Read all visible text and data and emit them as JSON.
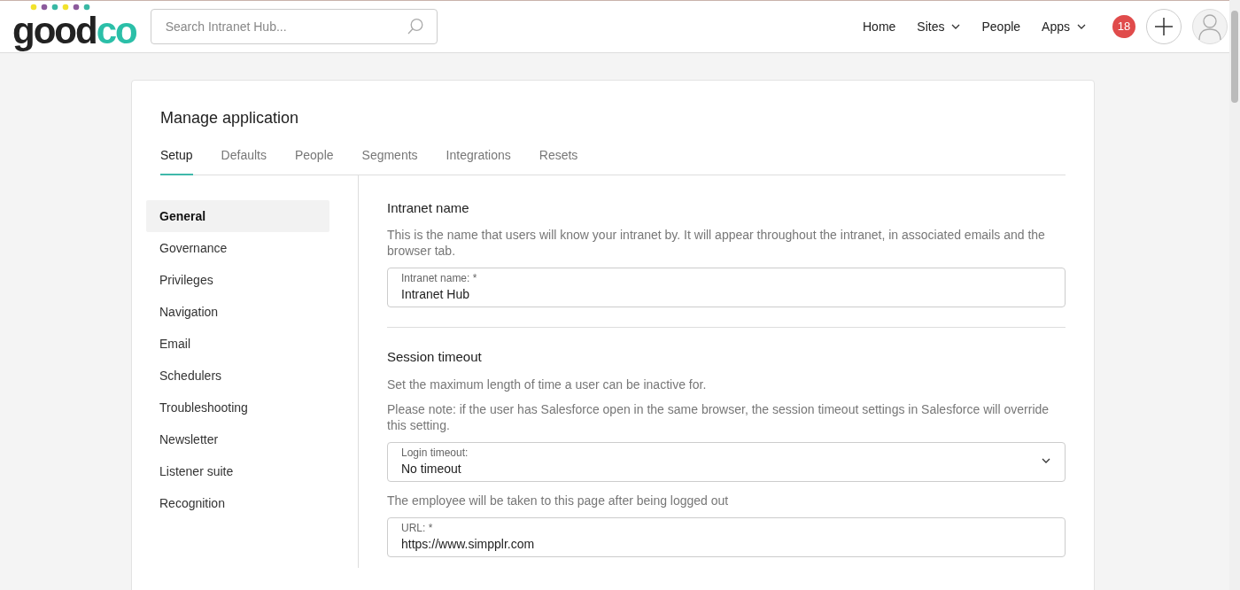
{
  "header": {
    "logo": {
      "main": "good",
      "accent": "co"
    },
    "search": {
      "placeholder": "Search Intranet Hub..."
    },
    "nav": [
      {
        "label": "Home",
        "dropdown": false
      },
      {
        "label": "Sites",
        "dropdown": true
      },
      {
        "label": "People",
        "dropdown": false
      },
      {
        "label": "Apps",
        "dropdown": true
      }
    ],
    "notifications": "18"
  },
  "title": "Manage application",
  "tabs": [
    {
      "label": "Setup",
      "selected": true
    },
    {
      "label": "Defaults",
      "selected": false
    },
    {
      "label": "People",
      "selected": false
    },
    {
      "label": "Segments",
      "selected": false
    },
    {
      "label": "Integrations",
      "selected": false
    },
    {
      "label": "Resets",
      "selected": false
    }
  ],
  "sidebar": {
    "items": [
      {
        "label": "General",
        "selected": true
      },
      {
        "label": "Governance",
        "selected": false
      },
      {
        "label": "Privileges",
        "selected": false
      },
      {
        "label": "Navigation",
        "selected": false
      },
      {
        "label": "Email",
        "selected": false
      },
      {
        "label": "Schedulers",
        "selected": false
      },
      {
        "label": "Troubleshooting",
        "selected": false
      },
      {
        "label": "Newsletter",
        "selected": false
      },
      {
        "label": "Listener suite",
        "selected": false
      },
      {
        "label": "Recognition",
        "selected": false
      }
    ]
  },
  "sections": [
    {
      "heading": "Intranet name",
      "items": [
        {
          "kind": "text",
          "text": "This is the name that users will know your intranet by. It will appear throughout the intranet, in associated emails and the browser tab."
        },
        {
          "kind": "input",
          "label": "Intranet name: *",
          "value": "Intranet Hub"
        }
      ]
    },
    {
      "heading": "Session timeout",
      "items": [
        {
          "kind": "text",
          "text": "Set the maximum length of time a user can be inactive for."
        },
        {
          "kind": "text",
          "text": "Please note: if the user has Salesforce open in the same browser, the session timeout settings in Salesforce will override this setting."
        },
        {
          "kind": "select",
          "label": "Login timeout:",
          "value": "No timeout"
        },
        {
          "kind": "text",
          "text": "The employee will be taken to this page after being logged out"
        },
        {
          "kind": "input",
          "label": "URL: *",
          "value": "https://www.simpplr.com"
        }
      ]
    }
  ]
}
